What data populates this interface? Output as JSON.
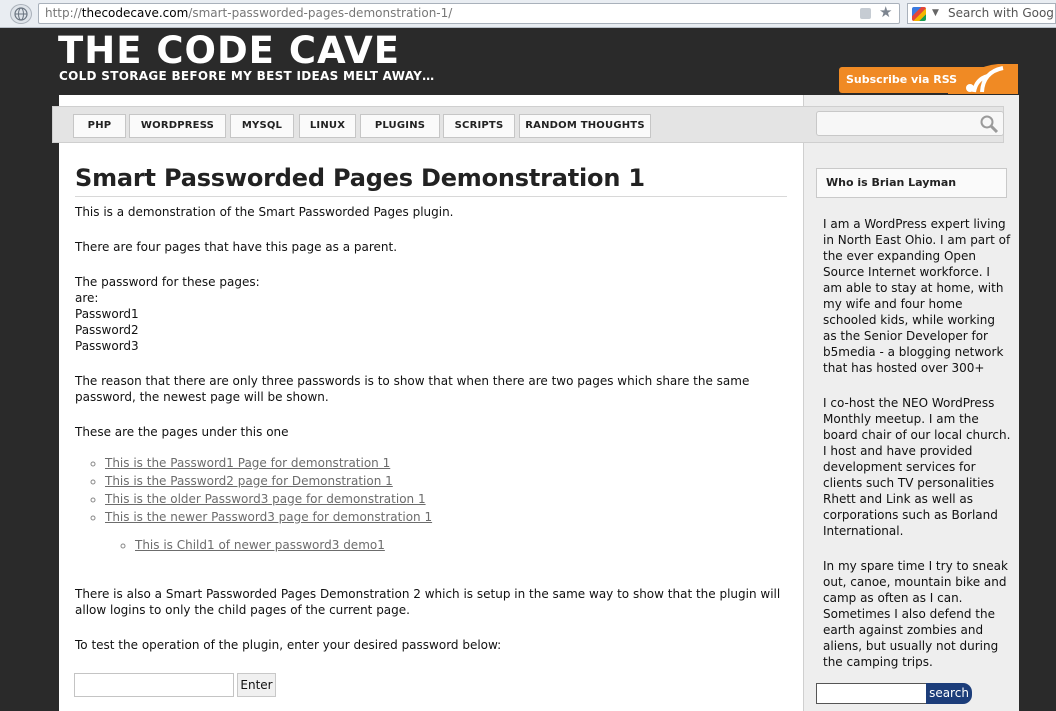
{
  "browser": {
    "url_prefix": "http://",
    "url_domain": "thecodecave.com",
    "url_path": "/smart-passworded-pages-demonstration-1/",
    "search_placeholder": "Search with Google"
  },
  "header": {
    "site_title": "THE CODE CAVE",
    "tagline": "COLD STORAGE BEFORE MY BEST IDEAS MELT AWAY…",
    "subscribe_label": "Subscribe via RSS"
  },
  "nav": {
    "items": [
      "PHP",
      "WORDPRESS",
      "MYSQL",
      "LINUX",
      "PLUGINS",
      "SCRIPTS",
      "RANDOM THOUGHTS"
    ]
  },
  "post": {
    "title": "Smart Passworded Pages Demonstration 1",
    "intro": "This is a demonstration of the Smart Passworded Pages plugin.",
    "parent_note": "There are four pages that have this page as a parent.",
    "passwords_heading": "The password for these pages:",
    "passwords_are": "are:",
    "passwords": [
      "Password1",
      "Password2",
      "Password3"
    ],
    "reason": "The reason that there are only three passwords is to show that when there are two pages which share the same password, the newest page will be shown.",
    "pages_heading": "These are the pages under this one",
    "child_links": [
      "This is the Password1 Page for demonstration 1",
      "This is the Password2 page for Demonstration 1",
      "This is the older Password3 page for demonstration 1",
      "This is the newer Password3 page for demonstration 1"
    ],
    "grandchild_link": "This is Child1 of newer password3 demo1",
    "demo2_note": "There is also a Smart Passworded Pages Demonstration 2 which is setup in the same way to show that the plugin will allow logins to only the child pages of the current page.",
    "test_note": "To test the operation of the plugin, enter your desired password below:",
    "password_value": "",
    "enter_label": "Enter"
  },
  "sidebar": {
    "widget_title": "Who is Brian Layman",
    "bio": [
      "I am a WordPress expert living in North East Ohio. I am part of the ever expanding Open Source Internet workforce. I am able to stay at home, with my wife and four home schooled kids, while working as the Senior Developer for b5media - a blogging network that has hosted over 300+",
      "I co-host the NEO WordPress Monthly meetup. I am the board chair of our local church. I host and have provided development services for clients such TV personalities Rhett and Link as well as corporations such as Borland International.",
      "In my spare time I try to sneak out, canoe, mountain bike and camp as often as I can. Sometimes I also defend the earth against zombies and aliens, but usually not during the camping trips."
    ],
    "search_value": "",
    "search_button": "search"
  },
  "colors": {
    "background": "#2a2a2a",
    "rss_orange": "#f08a24",
    "search_button": "#1c3d7a"
  },
  "icons": [
    "globe-icon",
    "rss-feed-icon",
    "bookmark-star-icon",
    "google-icon",
    "magnifier-icon",
    "rss-icon"
  ]
}
